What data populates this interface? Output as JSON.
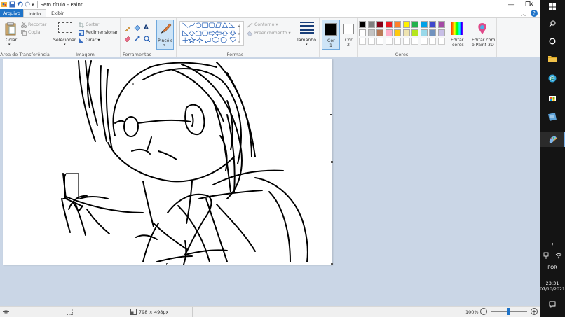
{
  "window": {
    "title": "Sem título - Paint"
  },
  "menu": {
    "file": "Arquivo",
    "tabs": [
      "Início",
      "Exibir"
    ]
  },
  "ribbon": {
    "clipboard": {
      "paste": "Colar",
      "cut": "Recortar",
      "copy": "Copiar",
      "group": "Área de Transferência"
    },
    "image": {
      "select": "Selecionar",
      "crop": "Cortar",
      "resize": "Redimensionar",
      "rotate": "Girar ▾",
      "group": "Imagem"
    },
    "tools": {
      "group": "Ferramentas"
    },
    "brushes": {
      "label": "Pincéis"
    },
    "shapes": {
      "outline": "Contorno ▾",
      "fill": "Preenchimento ▾",
      "group": "Formas"
    },
    "size": {
      "label": "Tamanho"
    },
    "color1": {
      "label": "Cor",
      "num": "1"
    },
    "color2": {
      "label": "Cor",
      "num": "2"
    },
    "colors": {
      "group": "Cores",
      "edit_line1": "Editar",
      "edit_line2": "cores",
      "paint3d_line1": "Editar com",
      "paint3d_line2": "o Paint 3D"
    },
    "palette_row1": [
      "#000000",
      "#7f7f7f",
      "#880015",
      "#ed1c24",
      "#ff7f27",
      "#fff200",
      "#22b14c",
      "#00a2e8",
      "#3f48cc",
      "#a349a4"
    ],
    "palette_row2": [
      "#ffffff",
      "#c3c3c3",
      "#b97a57",
      "#ffaec9",
      "#ffc90e",
      "#efe4b0",
      "#b5e61d",
      "#99d9ea",
      "#7092be",
      "#c8bfe7"
    ]
  },
  "status": {
    "dimensions": "798 × 498px",
    "zoom": "100%"
  },
  "taskbar": {
    "language": "POR",
    "time": "23:31",
    "date": "07/10/2021"
  }
}
